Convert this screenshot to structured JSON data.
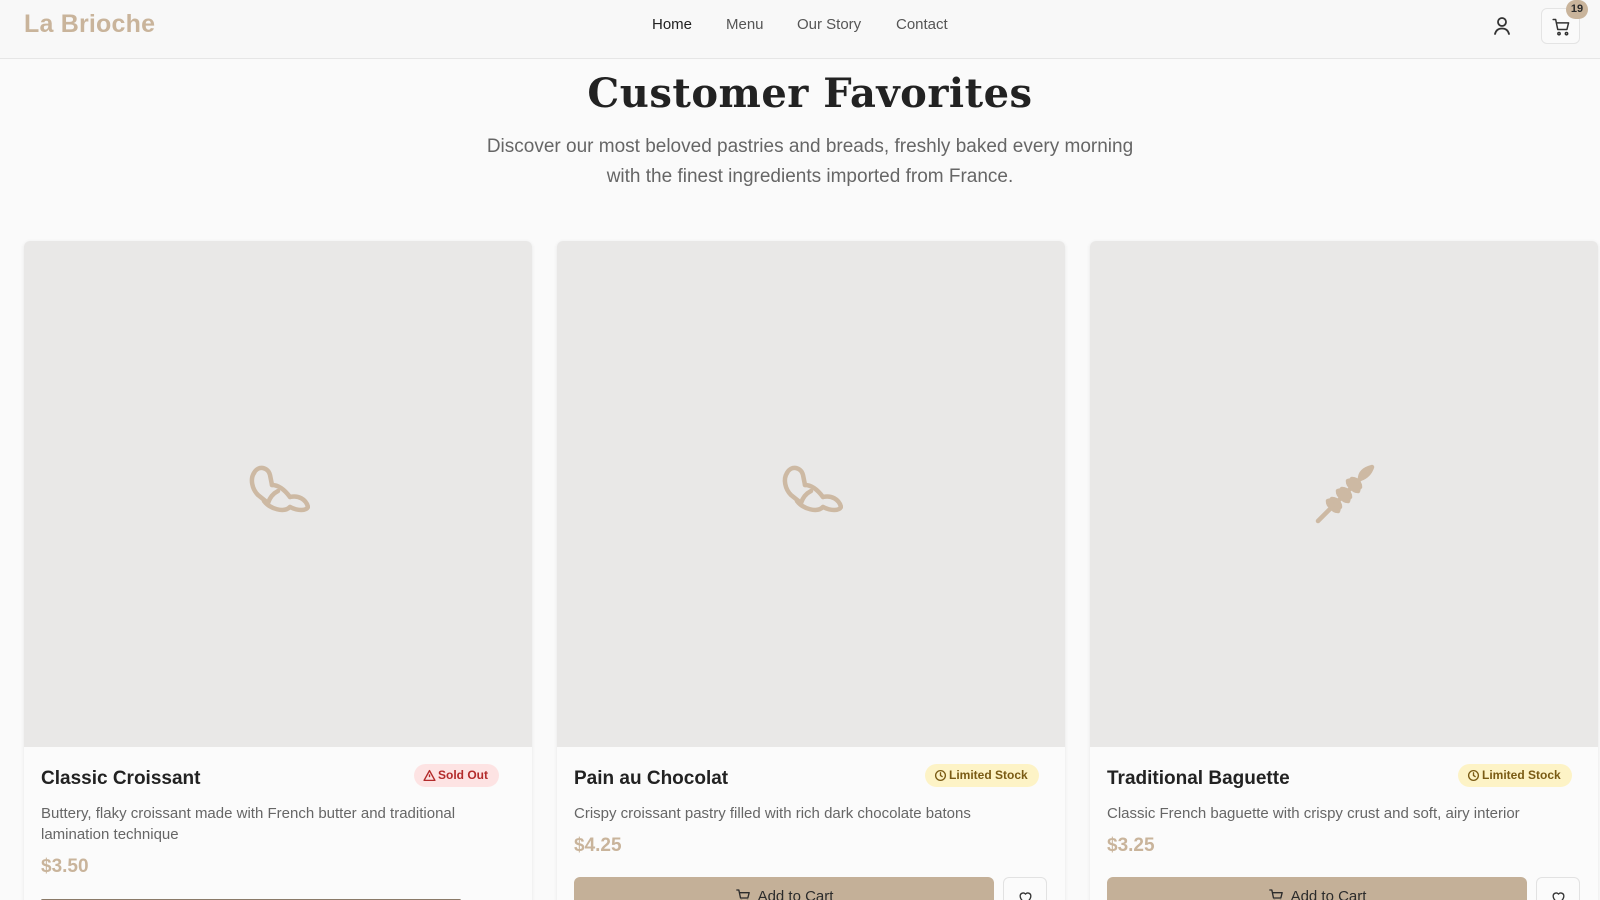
{
  "header": {
    "logo": "La Brioche",
    "nav": [
      {
        "label": "Home",
        "active": true
      },
      {
        "label": "Menu",
        "active": false
      },
      {
        "label": "Our Story",
        "active": false
      },
      {
        "label": "Contact",
        "active": false
      }
    ],
    "user_icon": "user-icon",
    "cart_icon": "cart-icon",
    "cart_count": "19"
  },
  "hero": {
    "title": "Customer Favorites",
    "subtitle_line1": "Discover our most beloved pastries and breads, freshly baked every morning",
    "subtitle_line2": "with the finest ingredients imported from France."
  },
  "products": [
    {
      "name": "Classic Croissant",
      "badge": "Sold Out",
      "badge_type": "sold",
      "badge_icon": "warning-triangle-icon",
      "image_icon": "croissant-icon",
      "description": "Buttery, flaky croissant made with French butter and traditional lamination technique",
      "price": "$3.50"
    },
    {
      "name": "Pain au Chocolat",
      "badge": "Limited Stock",
      "badge_type": "limited",
      "badge_icon": "clock-icon",
      "image_icon": "croissant-icon",
      "description": "Crispy croissant pastry filled with rich dark chocolate batons",
      "price": "$4.25",
      "add_label": "Add to Cart"
    },
    {
      "name": "Traditional Baguette",
      "badge": "Limited Stock",
      "badge_type": "limited",
      "badge_icon": "clock-icon",
      "image_icon": "wheat-icon",
      "description": "Classic French baguette with crispy crust and soft, airy interior",
      "price": "$3.25",
      "add_label": "Add to Cart"
    }
  ],
  "colors": {
    "accent": "#c9b49b",
    "button": "#c4b098",
    "sold_bg": "#fde3e3",
    "sold_text": "#b32b2b",
    "limited_bg": "#fdf3c6",
    "limited_text": "#7a5b14"
  }
}
